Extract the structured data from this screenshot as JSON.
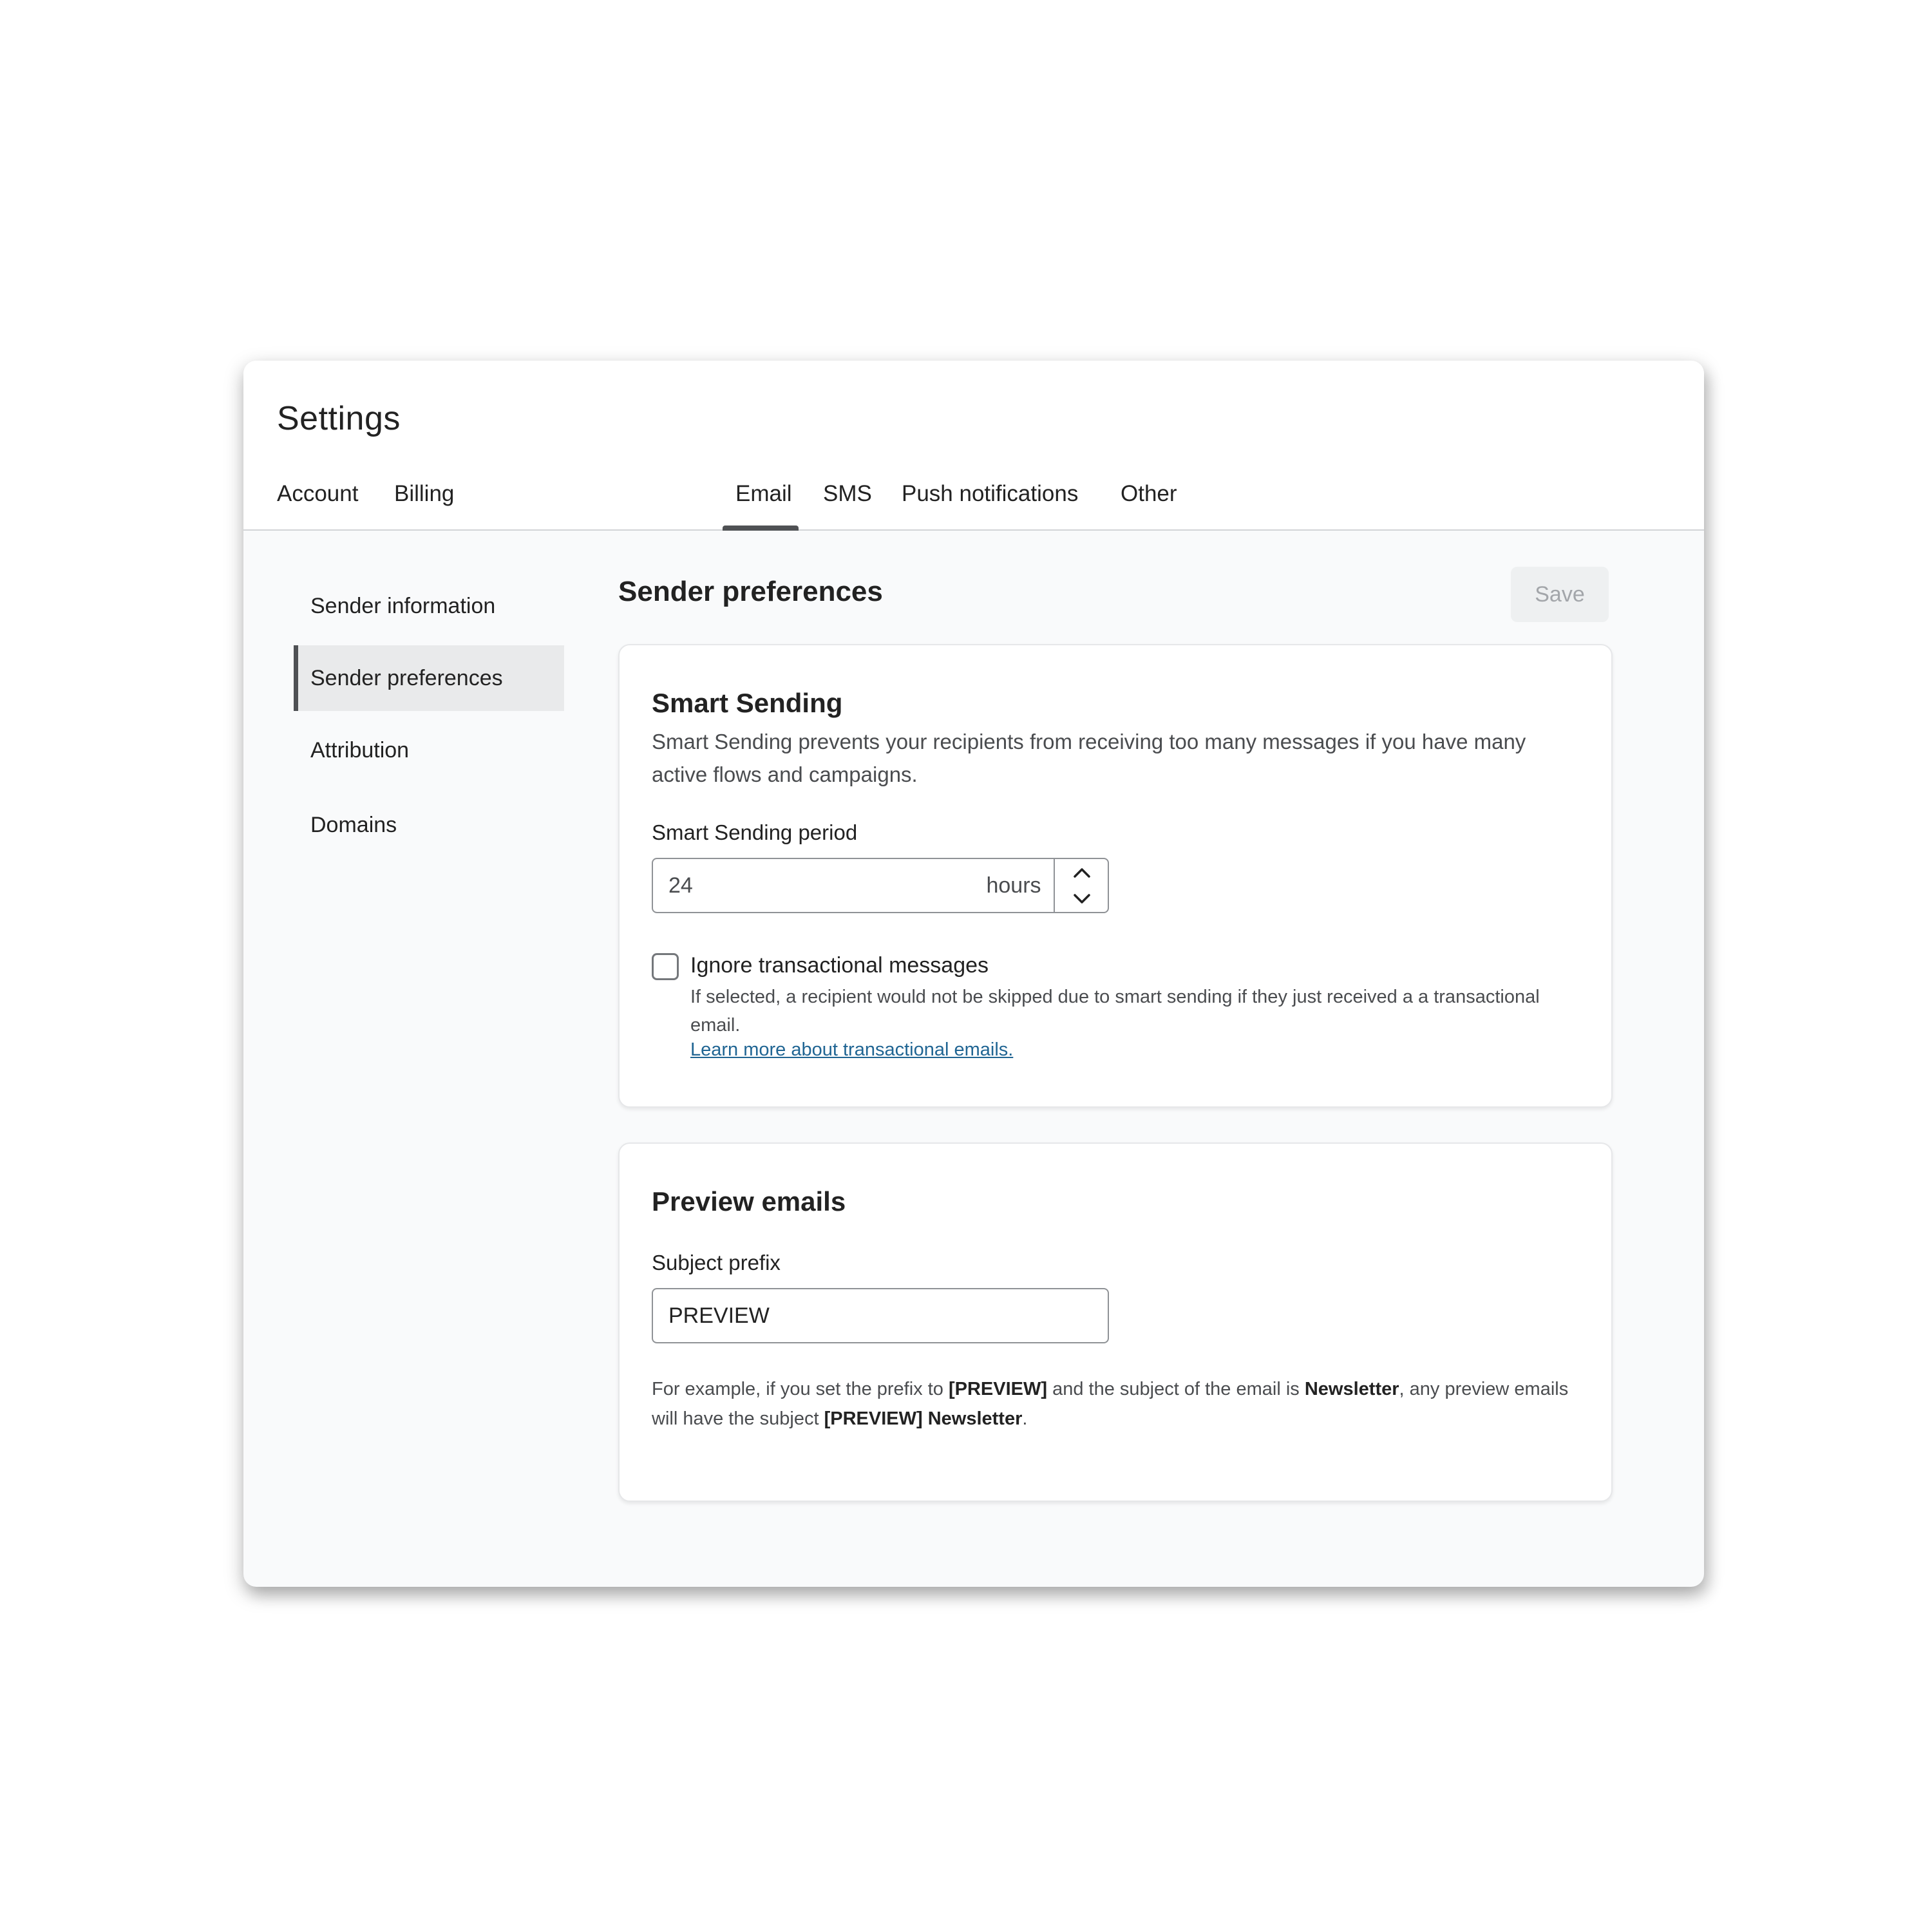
{
  "header": {
    "title": "Settings",
    "tabs": [
      {
        "label": "Account"
      },
      {
        "label": "Billing"
      },
      {
        "label": "Email",
        "active": true
      },
      {
        "label": "SMS"
      },
      {
        "label": "Push notifications"
      },
      {
        "label": "Other"
      }
    ]
  },
  "sidebar": {
    "items": [
      {
        "label": "Sender information"
      },
      {
        "label": "Sender preferences",
        "active": true
      },
      {
        "label": "Attribution"
      },
      {
        "label": "Domains"
      }
    ]
  },
  "main": {
    "title": "Sender preferences",
    "save_label": "Save",
    "smart_sending": {
      "title": "Smart Sending",
      "description": "Smart Sending prevents your recipients from receiving too many messages if you have many active flows and campaigns.",
      "period_label": "Smart Sending period",
      "period_value": "24",
      "period_unit": "hours",
      "checkbox_label": "Ignore transactional messages",
      "checkbox_checked": false,
      "checkbox_help": "If selected, a recipient would not be skipped due to smart sending if they just received a a transactional email.",
      "link_text": "Learn more about transactional emails."
    },
    "preview": {
      "title": "Preview emails",
      "prefix_label": "Subject prefix",
      "prefix_value": "PREVIEW",
      "example": {
        "t1": "For example, if you set the prefix to ",
        "b1": "[PREVIEW]",
        "t2": " and the subject of the email is ",
        "b2": "Newsletter",
        "t3": ", any preview emails will have the subject ",
        "b3": "[PREVIEW] Newsletter",
        "t4": "."
      }
    }
  },
  "colors": {
    "accent_dark": "#4f5154",
    "link": "#206593",
    "disabled_text": "#a3a6aa",
    "panel_bg": "#f9fafb"
  }
}
